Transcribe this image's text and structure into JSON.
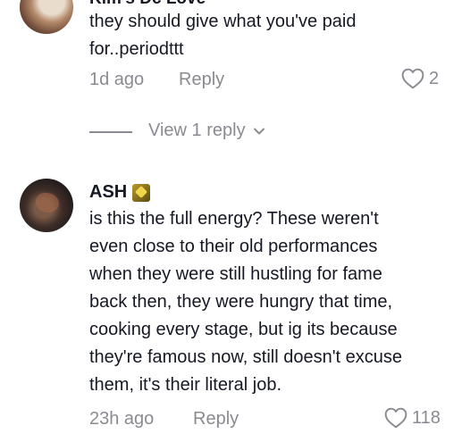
{
  "comment1": {
    "username": "Kim's Dc Love",
    "text_line1": "they should give what you've paid",
    "text_line2": "for..periodttt",
    "time": "1d ago",
    "reply_label": "Reply",
    "likes": "2"
  },
  "replies_toggle": {
    "label": "View 1 reply"
  },
  "comment2": {
    "username": "ASH",
    "text_lines": [
      "is this the full energy? These weren't",
      "even close to their old performances",
      "when they were still hustling for fame",
      "back then, they were hungry that time,",
      "cooking every stage, but ig its because",
      "they're famous now, still doesn't excuse",
      "them, it's their literal job."
    ],
    "time": "23h ago",
    "reply_label": "Reply",
    "likes": "118"
  },
  "icons": {
    "like": "heart-outline-icon",
    "expand": "chevron-down-icon",
    "badge": "badge-icon"
  },
  "colors": {
    "text_primary": "#161823",
    "text_secondary": "#8a8b91",
    "background": "#ffffff"
  }
}
